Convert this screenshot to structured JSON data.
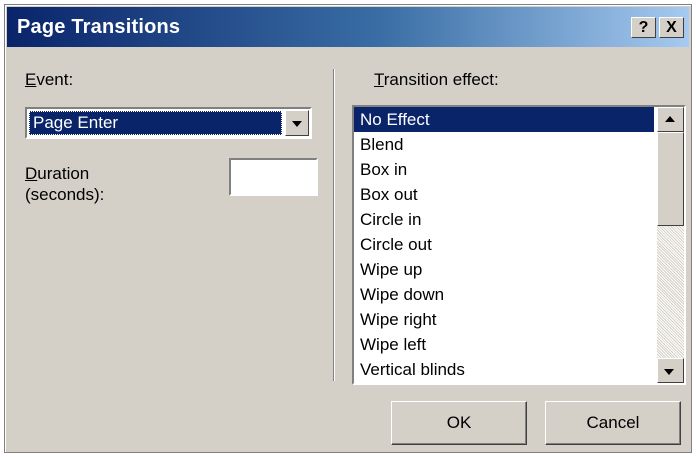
{
  "window": {
    "title": "Page Transitions",
    "help_label": "?",
    "close_label": "X"
  },
  "event": {
    "label": "Event:",
    "selected": "Page Enter"
  },
  "duration": {
    "label_line1": "Duration",
    "label_line2": "(seconds):",
    "value": ""
  },
  "transition": {
    "label": "Transition effect:",
    "items": [
      "No Effect",
      "Blend",
      "Box in",
      "Box out",
      "Circle in",
      "Circle out",
      "Wipe up",
      "Wipe down",
      "Wipe right",
      "Wipe left",
      "Vertical blinds"
    ],
    "selected_index": 0
  },
  "buttons": {
    "ok_label": "OK",
    "cancel_label": "Cancel"
  },
  "colors": {
    "selection": "#0a246a",
    "face": "#d4d0c8"
  }
}
